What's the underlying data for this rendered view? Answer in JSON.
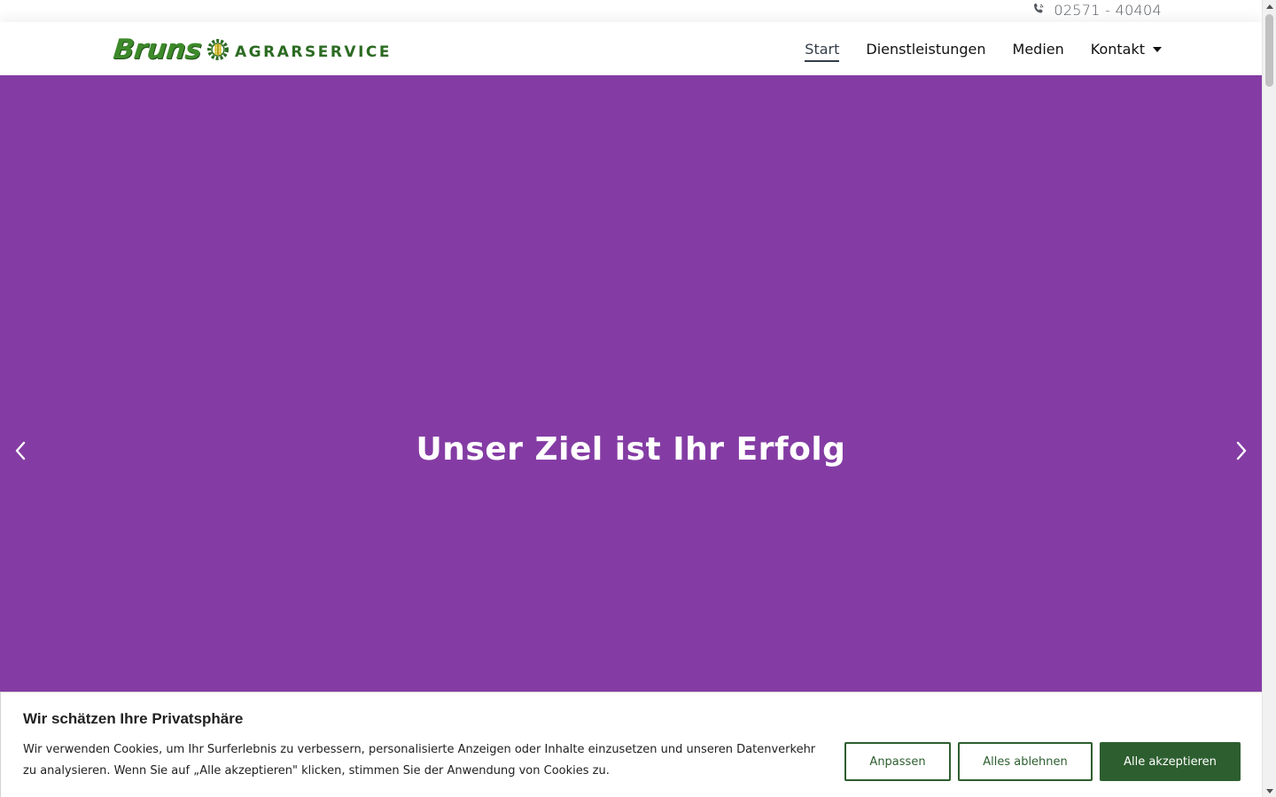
{
  "topbar": {
    "phone_icon": "phone-icon",
    "phone_number": "02571 - 40404"
  },
  "header": {
    "logo": {
      "brand": "Bruns",
      "tagline": "AGRARSERVICE",
      "icon": "gear-wheat-icon"
    },
    "nav": [
      {
        "label": "Start",
        "active": true
      },
      {
        "label": "Dienstleistungen",
        "active": false
      },
      {
        "label": "Medien",
        "active": false
      },
      {
        "label": "Kontakt",
        "active": false,
        "has_dropdown": true
      }
    ]
  },
  "hero": {
    "title": "Unser Ziel ist Ihr Erfolg",
    "background_color": "#843ca4",
    "prev_icon": "chevron-left-icon",
    "next_icon": "chevron-right-icon"
  },
  "cookie_banner": {
    "title": "Wir schätzen Ihre Privatsphäre",
    "text": "Wir verwenden Cookies, um Ihr Surferlebnis zu verbessern, personalisierte Anzeigen oder Inhalte einzusetzen und unseren Datenverkehr zu analysieren. Wenn Sie auf „Alle akzeptieren\" klicken, stimmen Sie der Anwendung von Cookies zu.",
    "buttons": {
      "customize": "Anpassen",
      "reject": "Alles ablehnen",
      "accept": "Alle akzeptieren"
    },
    "accent_color": "#2d5e2f"
  }
}
